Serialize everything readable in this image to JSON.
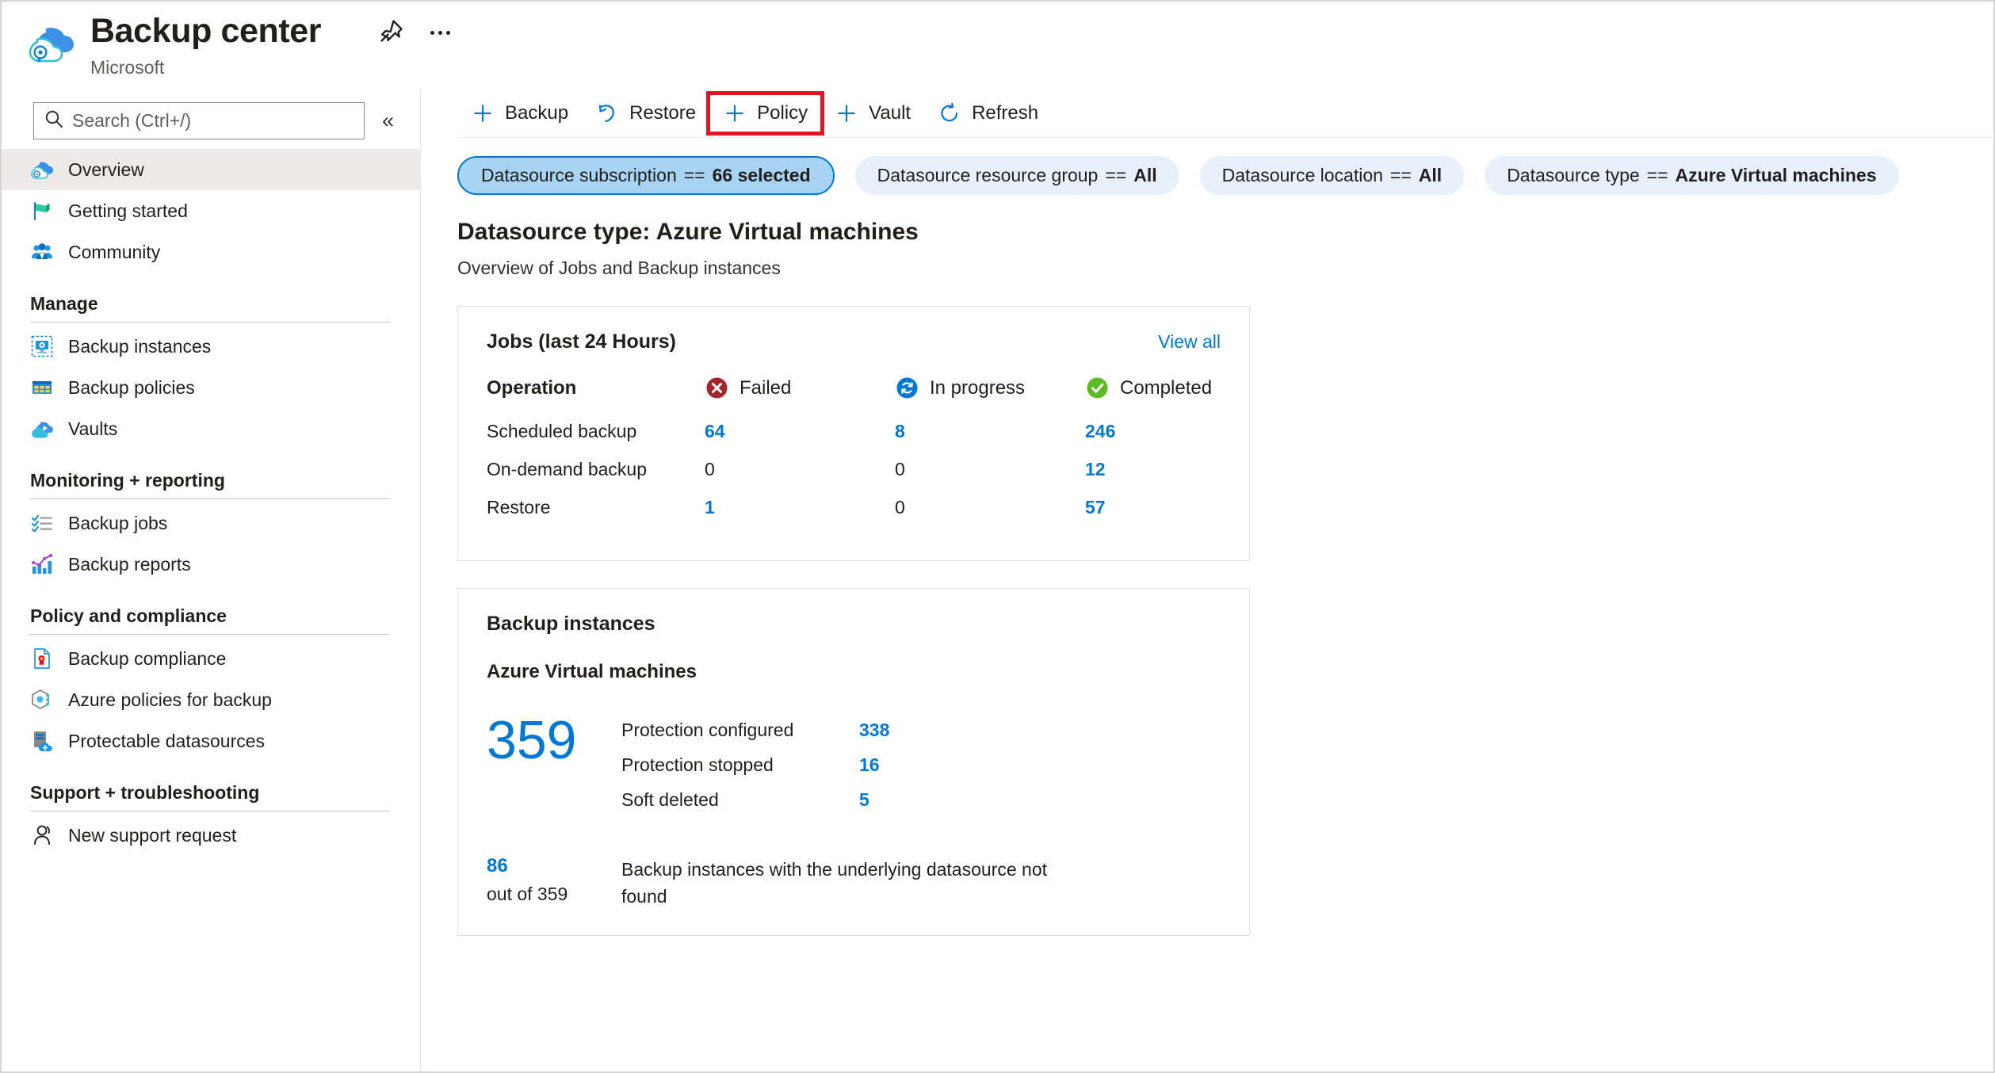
{
  "header": {
    "title": "Backup center",
    "subtitle": "Microsoft",
    "pin_icon": "pin-icon",
    "more_icon": "ellipsis-icon"
  },
  "sidebar": {
    "search": {
      "placeholder": "Search (Ctrl+/)",
      "value": "",
      "icon": "search-icon"
    },
    "collapse_label": "«",
    "top_items": [
      {
        "label": "Overview",
        "icon": "backup-center-cloud-icon",
        "active": true
      },
      {
        "label": "Getting started",
        "icon": "flag-icon",
        "active": false
      },
      {
        "label": "Community",
        "icon": "community-people-icon",
        "active": false
      }
    ],
    "sections": [
      {
        "title": "Manage",
        "items": [
          {
            "label": "Backup instances",
            "icon": "backup-instance-icon"
          },
          {
            "label": "Backup policies",
            "icon": "backup-policy-grid-icon"
          },
          {
            "label": "Vaults",
            "icon": "vault-cloud-icon"
          }
        ]
      },
      {
        "title": "Monitoring + reporting",
        "items": [
          {
            "label": "Backup jobs",
            "icon": "checklist-icon"
          },
          {
            "label": "Backup reports",
            "icon": "chart-report-icon"
          }
        ]
      },
      {
        "title": "Policy and compliance",
        "items": [
          {
            "label": "Backup compliance",
            "icon": "compliance-document-icon"
          },
          {
            "label": "Azure policies for backup",
            "icon": "azure-policy-hex-icon"
          },
          {
            "label": "Protectable datasources",
            "icon": "protectable-datasource-icon"
          }
        ]
      },
      {
        "title": "Support + troubleshooting",
        "items": [
          {
            "label": "New support request",
            "icon": "support-person-icon"
          }
        ]
      }
    ]
  },
  "commandbar": {
    "buttons": [
      {
        "label": "Backup",
        "icon": "plus-icon",
        "highlighted": false
      },
      {
        "label": "Restore",
        "icon": "restore-arrow-icon",
        "highlighted": false
      },
      {
        "label": "Policy",
        "icon": "plus-icon",
        "highlighted": true
      },
      {
        "label": "Vault",
        "icon": "plus-icon",
        "highlighted": false
      },
      {
        "label": "Refresh",
        "icon": "refresh-icon",
        "highlighted": false
      }
    ],
    "highlight_color": "#e81123"
  },
  "filters": [
    {
      "name": "Datasource subscription",
      "operator": "==",
      "value": "66 selected",
      "selected": true
    },
    {
      "name": "Datasource resource group",
      "operator": "==",
      "value": "All",
      "selected": false
    },
    {
      "name": "Datasource location",
      "operator": "==",
      "value": "All",
      "selected": false
    },
    {
      "name": "Datasource type",
      "operator": "==",
      "value": "Azure Virtual machines",
      "selected": false
    }
  ],
  "page": {
    "title": "Datasource type: Azure Virtual machines",
    "subtitle": "Overview of Jobs and Backup instances"
  },
  "jobs_card": {
    "title": "Jobs (last 24 Hours)",
    "view_all": "View all",
    "operation_header": "Operation",
    "status_headers": [
      {
        "label": "Failed",
        "icon": "failed-x-icon",
        "color": "#a4262c"
      },
      {
        "label": "In progress",
        "icon": "in-progress-sync-icon",
        "color": "#0078d4"
      },
      {
        "label": "Completed",
        "icon": "completed-check-icon",
        "color": "#5fb924"
      }
    ],
    "rows": [
      {
        "operation": "Scheduled backup",
        "failed": "64",
        "in_progress": "8",
        "completed": "246"
      },
      {
        "operation": "On-demand backup",
        "failed": "0",
        "in_progress": "0",
        "completed": "12"
      },
      {
        "operation": "Restore",
        "failed": "1",
        "in_progress": "0",
        "completed": "57"
      }
    ]
  },
  "instances_card": {
    "title": "Backup instances",
    "subtitle": "Azure Virtual machines",
    "total": "359",
    "rows": [
      {
        "label": "Protection configured",
        "value": "338"
      },
      {
        "label": "Protection stopped",
        "value": "16"
      },
      {
        "label": "Soft deleted",
        "value": "5"
      }
    ],
    "footer_num": "86",
    "footer_sub": "out of 359",
    "footer_text": "Backup instances with the underlying datasource not found"
  },
  "colors": {
    "accent": "#0078d4",
    "pill_bg": "#e8f1fb",
    "pill_selected_bg": "#a9d3f2",
    "failed": "#a4262c",
    "completed": "#5fb924",
    "highlight": "#e81123"
  }
}
